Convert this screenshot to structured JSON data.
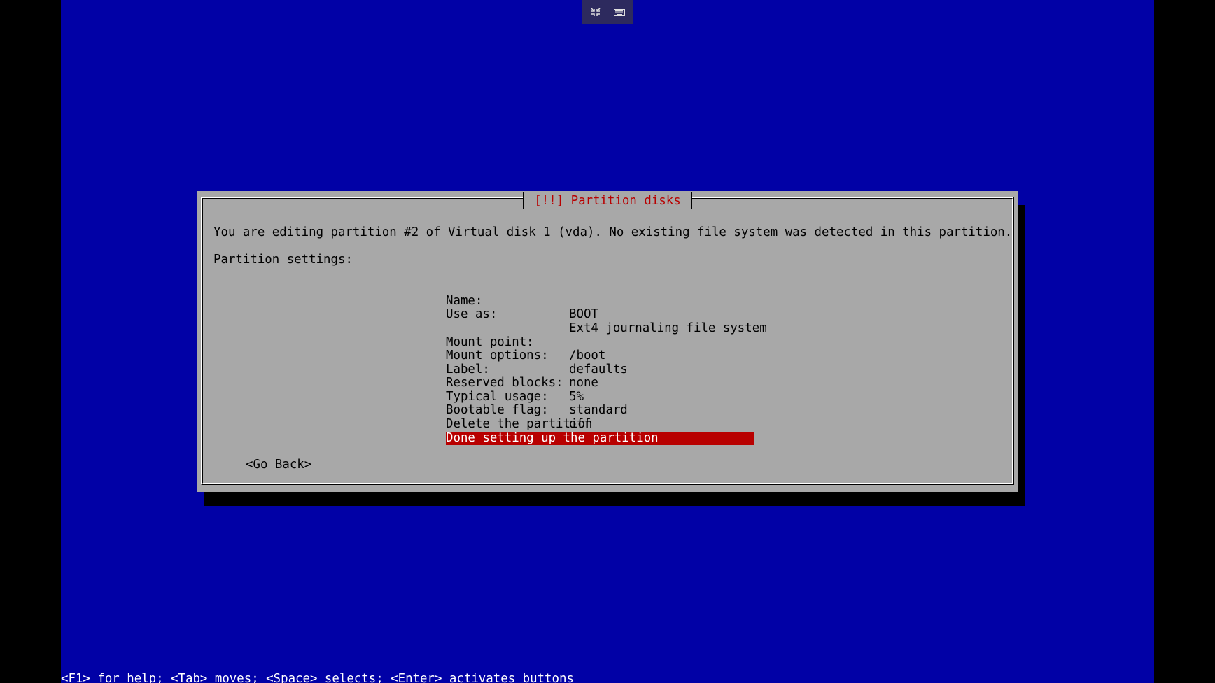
{
  "dialog": {
    "title": "[!!] Partition disks",
    "intro": "You are editing partition #2 of Virtual disk 1 (vda). No existing file system was detected in this partition.",
    "settings_heading": "Partition settings:",
    "settings": [
      {
        "label": "Name:",
        "value": "BOOT"
      },
      {
        "label": "Use as:",
        "value": "Ext4 journaling file system"
      },
      {
        "label": "Mount point:",
        "value": "/boot"
      },
      {
        "label": "Mount options:",
        "value": "defaults"
      },
      {
        "label": "Label:",
        "value": "none"
      },
      {
        "label": "Reserved blocks:",
        "value": "5%"
      },
      {
        "label": "Typical usage:",
        "value": "standard"
      },
      {
        "label": "Bootable flag:",
        "value": "off"
      }
    ],
    "actions": [
      {
        "label": "Delete the partition",
        "selected": false
      },
      {
        "label": "Done setting up the partition",
        "selected": true
      }
    ],
    "go_back": "<Go Back>"
  },
  "help_bar": "<F1> for help; <Tab> moves; <Space> selects; <Enter> activates buttons",
  "toolbar": {
    "icons": [
      "exit-fullscreen-icon",
      "keyboard-icon"
    ]
  },
  "colors": {
    "background": "#0101a6",
    "dialog": "#a8a8a8",
    "title": "#b80000",
    "selection": "#b80000"
  }
}
